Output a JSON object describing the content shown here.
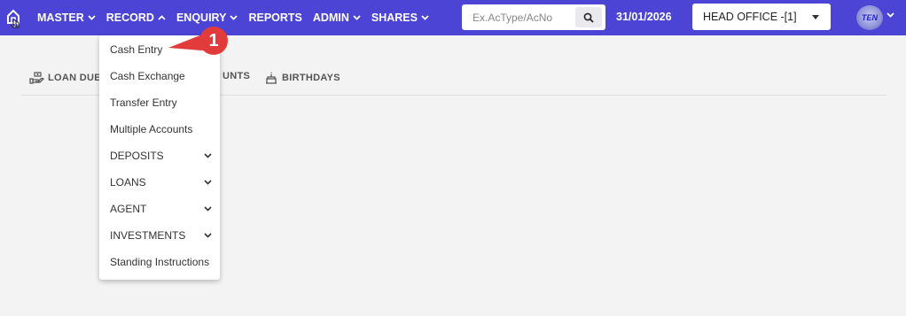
{
  "nav": {
    "items": [
      {
        "label": "MASTER",
        "has_dropdown": true
      },
      {
        "label": "RECORD",
        "has_dropdown": true,
        "open": true
      },
      {
        "label": "ENQUIRY",
        "has_dropdown": true
      },
      {
        "label": "REPORTS",
        "has_dropdown": false
      },
      {
        "label": "ADMIN",
        "has_dropdown": true
      },
      {
        "label": "SHARES",
        "has_dropdown": true
      }
    ]
  },
  "search": {
    "placeholder": "Ex.AcType/AcNo",
    "value": ""
  },
  "header": {
    "date": "31/01/2026",
    "branch": "HEAD OFFICE -[1]",
    "logo_text": "TEN"
  },
  "tabs": [
    {
      "label": "LOAN DUE",
      "icon": "hand-coin-icon"
    },
    {
      "label": "UNTS",
      "icon": ""
    },
    {
      "label": "BIRTHDAYS",
      "icon": "cake-icon"
    }
  ],
  "record_menu": {
    "items": [
      {
        "label": "Cash Entry",
        "has_submenu": false
      },
      {
        "label": "Cash Exchange",
        "has_submenu": false
      },
      {
        "label": "Transfer Entry",
        "has_submenu": false
      },
      {
        "label": "Multiple Accounts",
        "has_submenu": false
      },
      {
        "label": "DEPOSITS",
        "has_submenu": true
      },
      {
        "label": "LOANS",
        "has_submenu": true
      },
      {
        "label": "AGENT",
        "has_submenu": true
      },
      {
        "label": "INVESTMENTS",
        "has_submenu": true
      },
      {
        "label": "Standing Instructions",
        "has_submenu": false
      }
    ]
  },
  "callout": {
    "number": "1",
    "color": "#e23b3b"
  },
  "colors": {
    "topbar": "#4b44d4",
    "background": "#f3f3f3",
    "accent": "#e23b3b"
  }
}
